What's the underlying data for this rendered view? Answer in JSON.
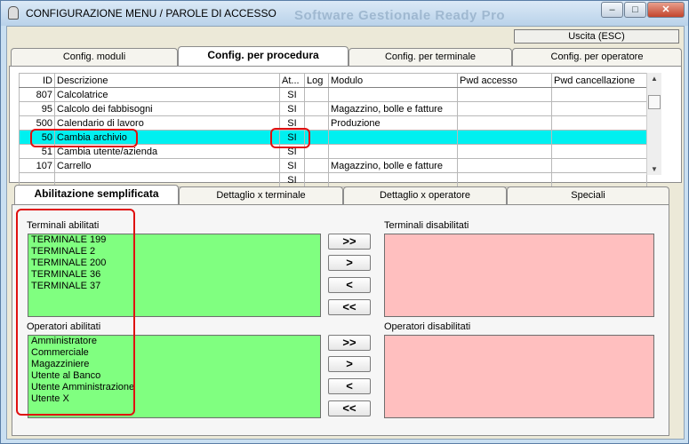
{
  "window": {
    "title": "CONFIGURAZIONE MENU / PAROLE DI ACCESSO",
    "background_title": "Software Gestionale Ready Pro",
    "minimize": "–",
    "maximize": "□",
    "close": "✕"
  },
  "uscita_label": "Uscita (ESC)",
  "top_tabs": [
    "Config. moduli",
    "Config. per procedura",
    "Config. per terminale",
    "Config. per operatore"
  ],
  "grid": {
    "columns": [
      "ID",
      "Descrizione",
      "At...",
      "Log",
      "Modulo",
      "Pwd accesso",
      "Pwd cancellazione"
    ],
    "rows": [
      [
        "807",
        "Calcolatrice",
        "SI",
        "",
        "",
        "",
        ""
      ],
      [
        "95",
        "Calcolo dei fabbisogni",
        "SI",
        "",
        "Magazzino, bolle e fatture",
        "",
        ""
      ],
      [
        "500",
        "Calendario di lavoro",
        "SI",
        "",
        "Produzione",
        "",
        ""
      ],
      [
        "50",
        "Cambia archivio",
        "SI",
        "",
        "",
        "",
        ""
      ],
      [
        "51",
        "Cambia utente/azienda",
        "SI",
        "",
        "",
        "",
        ""
      ],
      [
        "107",
        "Carrello",
        "SI",
        "",
        "Magazzino, bolle e fatture",
        "",
        ""
      ],
      [
        "",
        "",
        "SI",
        "",
        "",
        "",
        ""
      ]
    ],
    "selected_row": 3
  },
  "bottom_tabs": [
    "Abilitazione semplificata",
    "Dettaglio x terminale",
    "Dettaglio x operatore",
    "Speciali"
  ],
  "terminals": {
    "enabled_label": "Terminali abilitati",
    "disabled_label": "Terminali disabilitati",
    "enabled": [
      "TERMINALE 199",
      "TERMINALE 2",
      "TERMINALE 200",
      "TERMINALE 36",
      "TERMINALE 37"
    ],
    "disabled": []
  },
  "operators": {
    "enabled_label": "Operatori abilitati",
    "disabled_label": "Operatori disabilitati",
    "enabled": [
      "Amministratore",
      "Commerciale",
      "Magazziniere",
      "Utente al Banco",
      "Utente Amministrazione",
      "Utente X"
    ],
    "disabled": []
  },
  "move_buttons": {
    "all_right": ">>",
    "right": ">",
    "left": "<",
    "all_left": "<<"
  },
  "colors": {
    "enabled_list": "#80ff80",
    "disabled_list": "#ffbfbf",
    "selected_row": "#00f0f0",
    "highlight_annotation": "#e01010"
  }
}
